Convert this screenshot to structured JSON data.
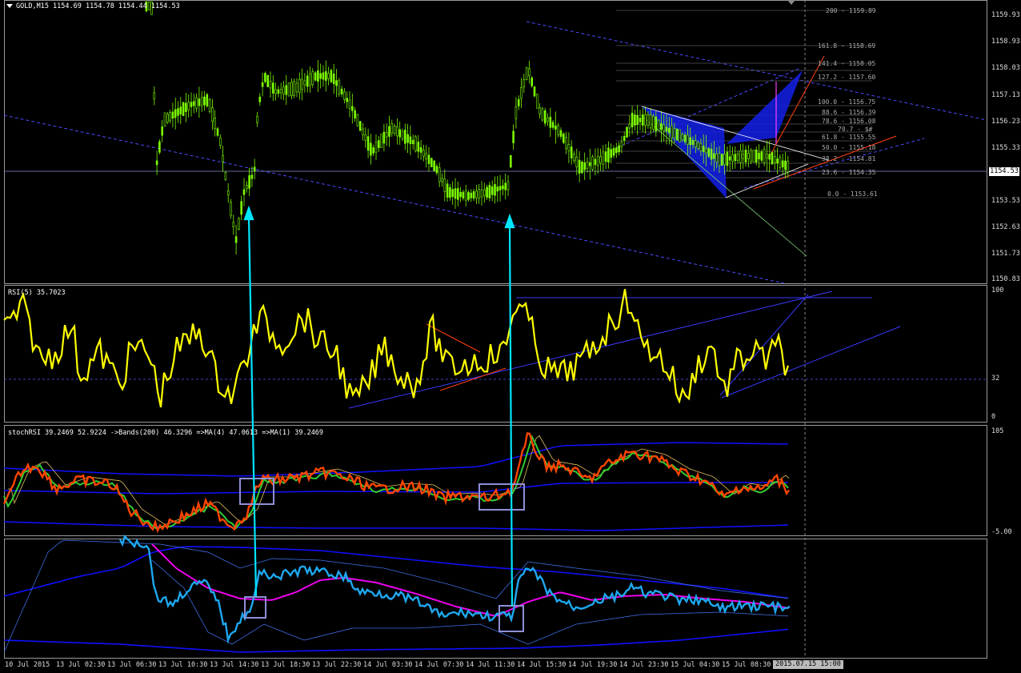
{
  "main": {
    "title": "GOLD,M15  1154.69 1154.78 1154.44 1154.53",
    "current_price": "1154.53",
    "price_ticks": [
      "1159.93",
      "1158.93",
      "1158.03",
      "1157.13",
      "1156.23",
      "1155.33",
      "1153.53",
      "1152.63",
      "1151.73",
      "1150.83"
    ],
    "fib_levels": [
      "200 - 1159.89",
      "161.8 - 1158.69",
      "141.4 - 1158.05",
      "127.2 - 1157.60",
      "100.0 - 1156.75",
      "88.6 - 1156.39",
      "78.6 - 1156.08",
      "70.7 - $#",
      "61.8 - 1155.55",
      "50.0 - 1155.18",
      "38.2 - 1154.81",
      "23.6 - 1154.35",
      "0.0 - 1153.61"
    ]
  },
  "rsi": {
    "label": "RSI(5) 35.7023",
    "ticks": [
      "100",
      "32",
      "0"
    ]
  },
  "stoch": {
    "label": "stochRSI 39.2469 52.9224  ->Bands(200) 46.3296  =>MA(4) 47.0613  =>MA(1) 39.2469",
    "ticks": [
      "105",
      "-5.00"
    ]
  },
  "x_ticks": [
    "10 Jul 2015",
    "13 Jul 02:30",
    "13 Jul 06:30",
    "13 Jul 10:30",
    "13 Jul 14:30",
    "13 Jul 18:30",
    "13 Jul 22:30",
    "14 Jul 03:30",
    "14 Jul 07:30",
    "14 Jul 11:30",
    "14 Jul 15:30",
    "14 Jul 19:30",
    "14 Jul 23:30",
    "15 Jul 04:30",
    "15 Jul 08:30"
  ],
  "cursor_time": "2015.07.15 15:00",
  "colors": {
    "candles": "#7CFC00",
    "rsi": "#FFFF00",
    "stoch_fast": "#FF4500",
    "stoch_slow": "#32CD32",
    "bands": "#1010FF",
    "lower_main": "#1EA8F0",
    "lower_ma": "#EE00EE",
    "arrows": "#00E5FF"
  }
}
